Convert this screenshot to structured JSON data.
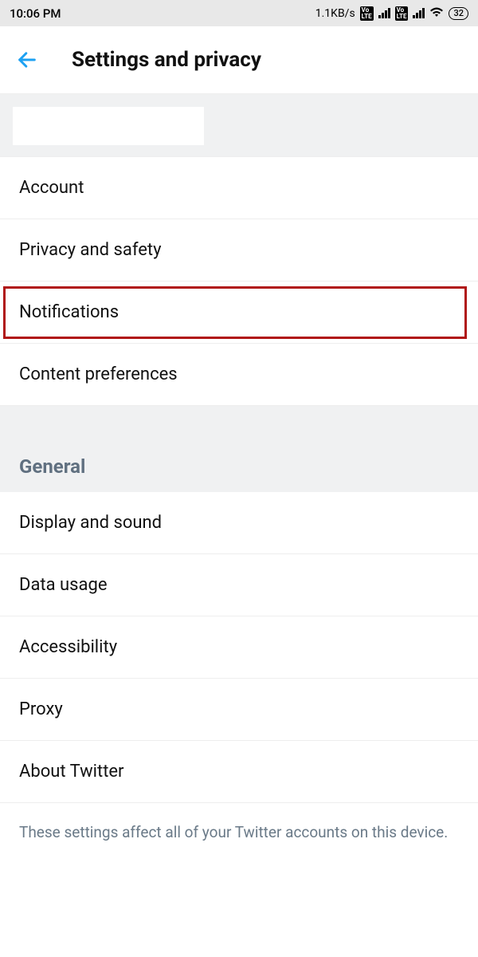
{
  "status": {
    "time": "10:06 PM",
    "speed": "1.1KB/s",
    "volte": "Vo LTE",
    "battery": "32"
  },
  "header": {
    "title": "Settings and privacy"
  },
  "items": {
    "account": "Account",
    "privacy": "Privacy and safety",
    "notifications": "Notifications",
    "content": "Content preferences",
    "display": "Display and sound",
    "data": "Data usage",
    "accessibility": "Accessibility",
    "proxy": "Proxy",
    "about": "About Twitter"
  },
  "section": {
    "general": "General"
  },
  "footer": {
    "note": "These settings affect all of your Twitter accounts on this device."
  }
}
